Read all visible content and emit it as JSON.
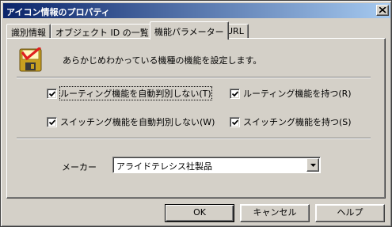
{
  "window": {
    "title": "アイコン情報のプロパティ"
  },
  "tabs": [
    {
      "label": "識別情報"
    },
    {
      "label": "オブジェクト ID の一覧"
    },
    {
      "label": "機能パラメーター"
    },
    {
      "label": "URL"
    }
  ],
  "panel": {
    "description": "あらかじめわかっている機種の機能を設定します。",
    "checkboxes": [
      {
        "label": "ルーティング機能を自動判別しない(T)",
        "checked": true
      },
      {
        "label": "ルーティング機能を持つ(R)",
        "checked": true
      },
      {
        "label": "スイッチング機能を自動判別しない(W)",
        "checked": true
      },
      {
        "label": "スイッチング機能を持つ(S)",
        "checked": true
      }
    ],
    "maker_label": "メーカー",
    "maker_value": "アライドテレシス社製品"
  },
  "buttons": {
    "ok": "OK",
    "cancel": "キャンセル",
    "help": "ヘルプ"
  },
  "icons": {
    "dialog_icon": "checklist-floppy-icon",
    "close": "close-icon",
    "dropdown": "chevron-down-icon"
  }
}
